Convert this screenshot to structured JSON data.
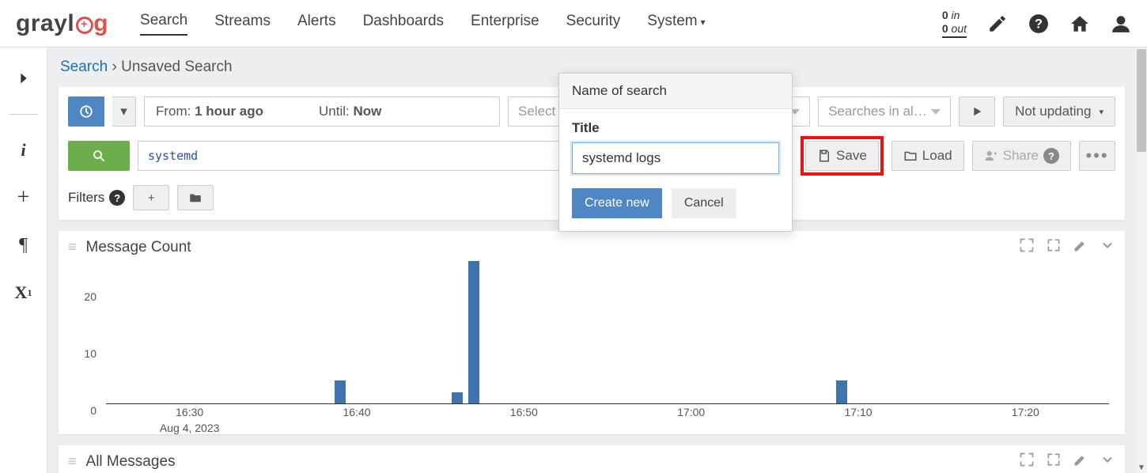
{
  "brand": {
    "part1": "grayl",
    "part2": "g"
  },
  "nav": {
    "search": "Search",
    "streams": "Streams",
    "alerts": "Alerts",
    "dashboards": "Dashboards",
    "enterprise": "Enterprise",
    "security": "Security",
    "system": "System"
  },
  "io": {
    "in_count": "0",
    "in_label": "in",
    "out_count": "0",
    "out_label": "out"
  },
  "crumbs": {
    "root": "Search",
    "sep": "›",
    "current": "Unsaved Search"
  },
  "timerange": {
    "from_label": "From:",
    "from_value": "1 hour ago",
    "until_label": "Until:",
    "until_value": "Now"
  },
  "streams_select_placeholder": "Select streams",
  "saved_searches_placeholder": "Searches in al…",
  "updating_label": "Not updating",
  "query": "systemd",
  "buttons": {
    "save": "Save",
    "load": "Load",
    "share": "Share"
  },
  "filters_label": "Filters",
  "modal": {
    "header": "Name of search",
    "title_label": "Title",
    "title_value": "systemd logs",
    "create": "Create new",
    "cancel": "Cancel"
  },
  "widgets": {
    "message_count": "Message Count",
    "all_messages": "All Messages"
  },
  "chart_data": {
    "type": "bar",
    "title": "Message Count",
    "xlabel": "Aug 4, 2023",
    "ylabel": "",
    "ylim": [
      0,
      25
    ],
    "y_ticks": [
      0,
      10,
      20
    ],
    "x_ticks": [
      "16:30",
      "16:40",
      "16:50",
      "17:00",
      "17:10",
      "17:20"
    ],
    "x_date": "Aug 4, 2023",
    "bars": [
      {
        "t": "16:39",
        "v": 4
      },
      {
        "t": "16:46",
        "v": 2
      },
      {
        "t": "16:47",
        "v": 25
      },
      {
        "t": "17:09",
        "v": 4
      }
    ]
  }
}
